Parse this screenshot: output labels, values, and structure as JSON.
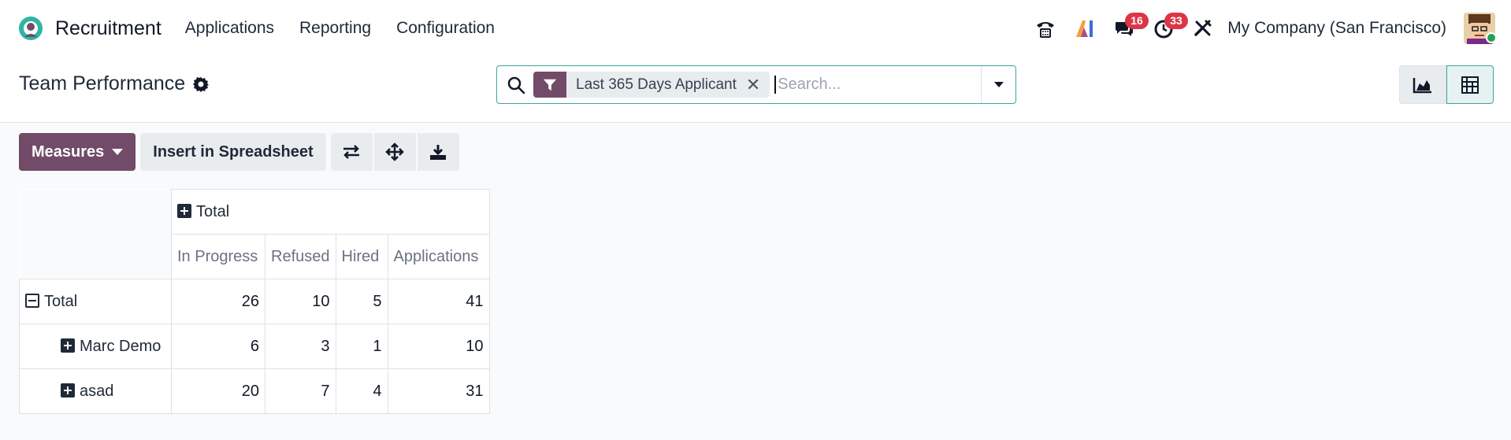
{
  "navbar": {
    "app_name": "Recruitment",
    "menu": [
      "Applications",
      "Reporting",
      "Configuration"
    ],
    "badges": {
      "messages": "16",
      "activities": "33"
    },
    "company": "My Company (San Francisco)"
  },
  "control": {
    "page_title": "Team Performance",
    "facet_label": "Last 365 Days Applicant",
    "facet_close": "✕",
    "search_placeholder": "Search..."
  },
  "toolbar": {
    "measures_label": "Measures",
    "insert_label": "Insert in Spreadsheet"
  },
  "pivot": {
    "col_header": "Total",
    "measures": [
      "In Progress",
      "Refused",
      "Hired",
      "Applications"
    ],
    "rows": [
      {
        "label": "Total",
        "values": [
          "26",
          "10",
          "5",
          "41"
        ]
      },
      {
        "label": "Marc Demo",
        "values": [
          "6",
          "3",
          "1",
          "10"
        ]
      },
      {
        "label": "asad",
        "values": [
          "20",
          "7",
          "4",
          "31"
        ]
      }
    ]
  },
  "colors": {
    "brand": "#714b67",
    "accent": "#3fa69e",
    "badge": "#dc3545"
  }
}
